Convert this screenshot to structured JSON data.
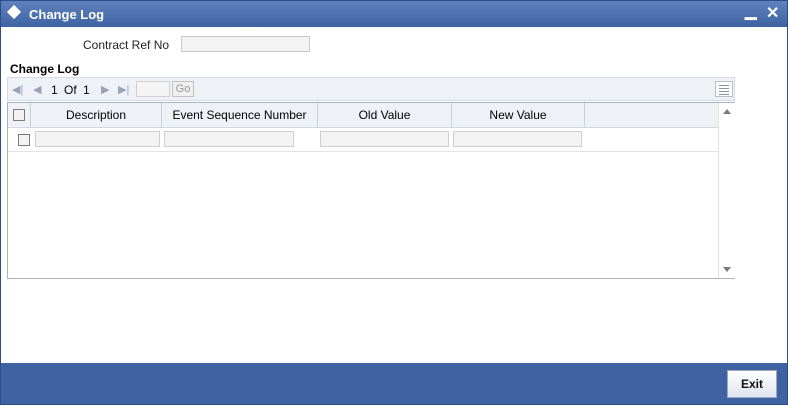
{
  "window": {
    "title": "Change Log",
    "minimize_symbol": "▁",
    "close_symbol": "✕"
  },
  "form": {
    "contract_ref_label": "Contract Ref No",
    "contract_ref_value": ""
  },
  "section": {
    "title": "Change Log"
  },
  "pager": {
    "first_icon": "◀|",
    "prev_icon": "◀",
    "current": "1",
    "of_label": "Of",
    "total": "1",
    "next_icon": "▶",
    "last_icon": "▶|",
    "page_input": "",
    "go_label": "Go"
  },
  "table": {
    "columns": [
      "Description",
      "Event Sequence Number",
      "Old Value",
      "New Value"
    ],
    "rows": [
      {
        "description": "",
        "event_sequence_number": "",
        "old_value": "",
        "new_value": ""
      }
    ]
  },
  "footer": {
    "exit_label": "Exit"
  },
  "colors": {
    "titlebar": "#3f62a2",
    "footer": "#3f62a2",
    "header_bg": "#eef1f6"
  }
}
